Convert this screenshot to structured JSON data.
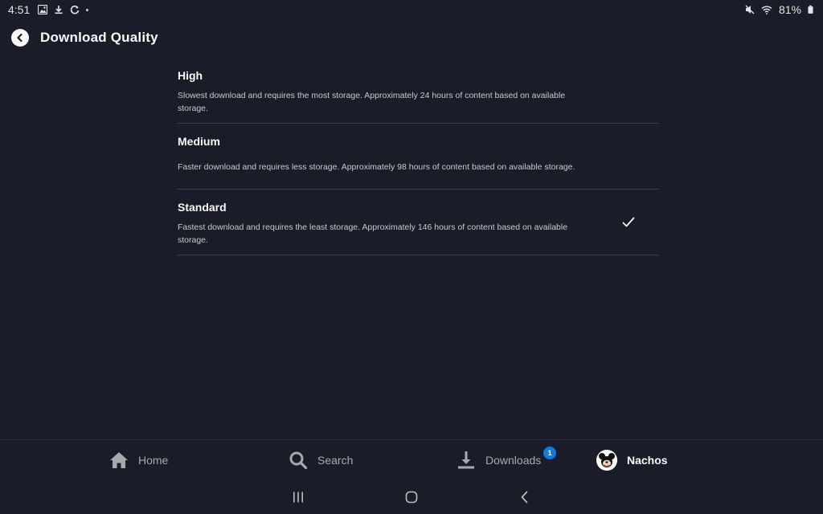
{
  "status_bar": {
    "time": "4:51",
    "battery": "81%",
    "icons_left": [
      "gallery-icon",
      "download-icon",
      "sync-icon",
      "dot"
    ],
    "icons_right": [
      "mute-icon",
      "wifi-icon",
      "battery-icon"
    ]
  },
  "header": {
    "title": "Download Quality",
    "back_icon": "back-arrow-icon"
  },
  "options": [
    {
      "title": "High",
      "description": "Slowest download and requires the most storage. Approximately 24 hours of content based on available storage.",
      "selected": false
    },
    {
      "title": "Medium",
      "description": "Faster download and requires less storage. Approximately 98 hours of content based on available storage.",
      "selected": false
    },
    {
      "title": "Standard",
      "description": "Fastest download and requires the least storage. Approximately 146 hours of content based on available storage.",
      "selected": true
    }
  ],
  "bottom_nav": {
    "home": "Home",
    "search": "Search",
    "downloads": "Downloads",
    "downloads_badge": "1",
    "profile": "Nachos"
  },
  "colors": {
    "background": "#1b1c29",
    "text": "#f9f9f9",
    "badge": "#0a7de0"
  }
}
